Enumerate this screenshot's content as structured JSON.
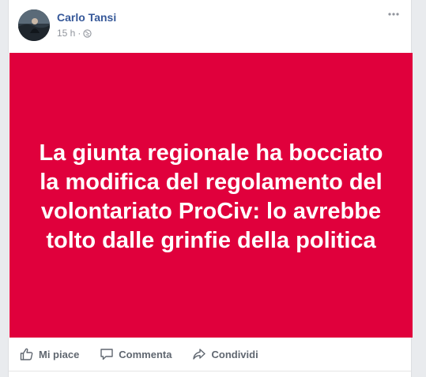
{
  "post": {
    "author": "Carlo Tansi",
    "time": "15 h",
    "separator": "·",
    "privacy_icon": "globe-icon",
    "menu_icon": "more-icon",
    "card": {
      "text": "La giunta regionale ha bocciato la modifica del regolamento del volontariato ProCiv: lo avrebbe tolto dalle grinfie della politica",
      "background": "#e0003c",
      "text_color": "#ffffff"
    },
    "actions": {
      "like": {
        "label": "Mi piace",
        "icon": "thumbs-up-icon"
      },
      "comment": {
        "label": "Commenta",
        "icon": "comment-icon"
      },
      "share": {
        "label": "Condividi",
        "icon": "share-icon"
      }
    },
    "colors": {
      "author_link": "#365899",
      "meta_text": "#90949c",
      "action_text": "#606770"
    }
  }
}
